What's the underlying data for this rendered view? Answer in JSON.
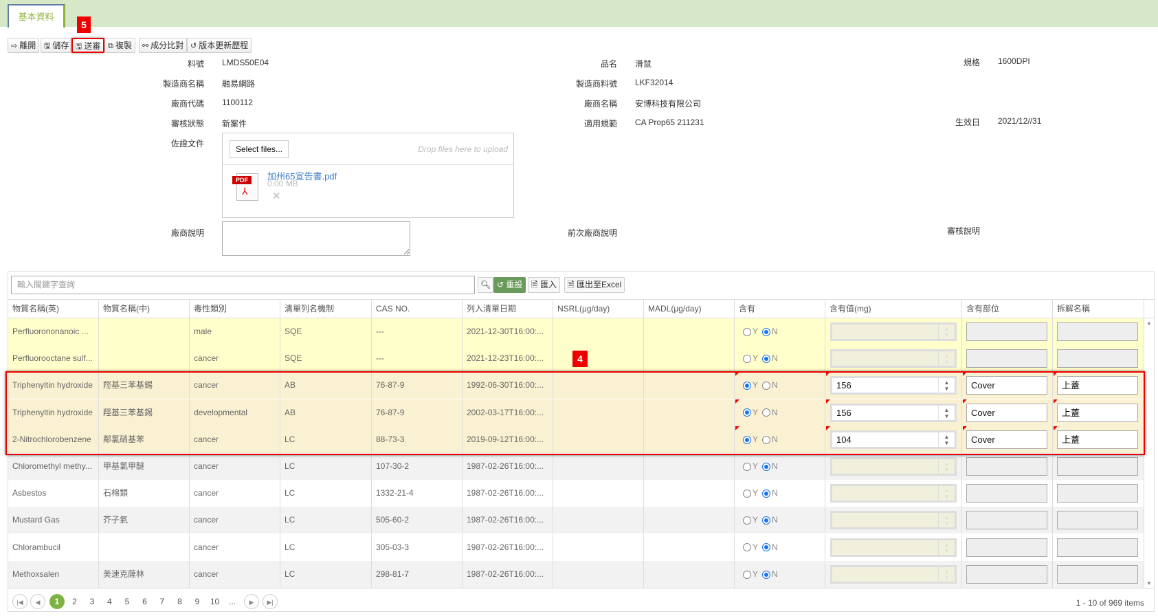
{
  "tab": "基本資料",
  "toolbar": [
    {
      "icon": "exit-icon",
      "glyph": "⇨",
      "label": "離開"
    },
    {
      "icon": "save-icon",
      "glyph": "🖫",
      "label": "儲存"
    },
    {
      "icon": "submit-icon",
      "glyph": "🖫",
      "label": "送審"
    },
    {
      "icon": "copy-icon",
      "glyph": "⧉",
      "label": "複製"
    },
    {
      "icon": "link-icon",
      "glyph": "⚯",
      "label": "成分比對"
    },
    {
      "icon": "history-icon",
      "glyph": "↺",
      "label": "版本更新歷程"
    }
  ],
  "annotations": {
    "submit": "5",
    "rows": "4"
  },
  "form": {
    "part_no": {
      "label": "料號",
      "value": "LMDS50E04"
    },
    "mfr_name": {
      "label": "製造商名稱",
      "value": "融易網路"
    },
    "vendor_code": {
      "label": "廠商代碼",
      "value": "1100112"
    },
    "review_status": {
      "label": "審核狀態",
      "value": "新案件"
    },
    "evidence": {
      "label": "佐證文件"
    },
    "product_name": {
      "label": "品名",
      "value": "滑鼠"
    },
    "mfr_part_no": {
      "label": "製造商料號",
      "value": "LKF32014"
    },
    "vendor_name": {
      "label": "廠商名稱",
      "value": "安博科技有限公司"
    },
    "regulation": {
      "label": "適用規範",
      "value": "CA Prop65 211231"
    },
    "spec": {
      "label": "規格",
      "value": "1600DPI"
    },
    "effective_date": {
      "label": "生效日",
      "value": "2021/12//31"
    },
    "vendor_note": {
      "label": "廠商說明",
      "value": ""
    },
    "prev_vendor_note": {
      "label": "前次廠商說明"
    },
    "review_note": {
      "label": "審核說明"
    }
  },
  "upload": {
    "select_label": "Select files...",
    "drop_hint": "Drop files here to upload",
    "file_name": "加州65宣告書.pdf",
    "file_size": "0.00 MB",
    "file_type": "PDF"
  },
  "grid": {
    "search_placeholder": "輸入關鍵字查詢",
    "reset_label": "重設",
    "import_label": "匯入",
    "export_label": "匯出至Excel",
    "columns": [
      "物質名稱(英)",
      "物質名稱(中)",
      "毒性類別",
      "清單列名機制",
      "CAS NO.",
      "列入清單日期",
      "NSRL(μg/day)",
      "MADL(μg/day)",
      "含有",
      "含有值(mg)",
      "含有部位",
      "拆解名稱"
    ],
    "rows": [
      {
        "en": "Perfluorononanoic ...",
        "zh": "",
        "tox": "male",
        "mech": "SQE",
        "cas": "---",
        "date": "2021-12-30T16:00:...",
        "nsrl": "",
        "madl": "",
        "contains": "N",
        "value": "",
        "part": "",
        "disassembly": "",
        "bg": "#ffffcc",
        "enabled": false
      },
      {
        "en": "Perfluorooctane sulf...",
        "zh": "",
        "tox": "cancer",
        "mech": "SQE",
        "cas": "---",
        "date": "2021-12-23T16:00:...",
        "nsrl": "",
        "madl": "",
        "contains": "N",
        "value": "",
        "part": "",
        "disassembly": "",
        "bg": "#ffffcc",
        "enabled": false
      },
      {
        "en": "Triphenyltin hydroxide",
        "zh": "羥基三苯基錫",
        "tox": "cancer",
        "mech": "AB",
        "cas": "76-87-9",
        "date": "1992-06-30T16:00:...",
        "nsrl": "",
        "madl": "",
        "contains": "Y",
        "value": "156",
        "part": "Cover",
        "disassembly": "上蓋",
        "bg": "#faf1d2",
        "enabled": true
      },
      {
        "en": "Triphenyltin hydroxide",
        "zh": "羥基三苯基錫",
        "tox": "developmental",
        "mech": "AB",
        "cas": "76-87-9",
        "date": "2002-03-17T16:00:...",
        "nsrl": "",
        "madl": "",
        "contains": "Y",
        "value": "156",
        "part": "Cover",
        "disassembly": "上蓋",
        "bg": "#faf1d2",
        "enabled": true
      },
      {
        "en": "2-Nitrochlorobenzene",
        "zh": "鄰氯硝基苯",
        "tox": "cancer",
        "mech": "LC",
        "cas": "88-73-3",
        "date": "2019-09-12T16:00:...",
        "nsrl": "",
        "madl": "",
        "contains": "Y",
        "value": "104",
        "part": "Cover",
        "disassembly": "上蓋",
        "bg": "#faf1d2",
        "enabled": true
      },
      {
        "en": "Chloromethyl methy...",
        "zh": "甲基氯甲醚",
        "tox": "cancer",
        "mech": "LC",
        "cas": "107-30-2",
        "date": "1987-02-26T16:00:...",
        "nsrl": "",
        "madl": "",
        "contains": "N",
        "value": "",
        "part": "",
        "disassembly": "",
        "bg": "#f2f2f2",
        "enabled": false
      },
      {
        "en": "Asbestos",
        "zh": "石棉類",
        "tox": "cancer",
        "mech": "LC",
        "cas": "1332-21-4",
        "date": "1987-02-26T16:00:...",
        "nsrl": "",
        "madl": "",
        "contains": "N",
        "value": "",
        "part": "",
        "disassembly": "",
        "bg": "#ffffff",
        "enabled": false
      },
      {
        "en": "Mustard Gas",
        "zh": "芥子氣",
        "tox": "cancer",
        "mech": "LC",
        "cas": "505-60-2",
        "date": "1987-02-26T16:00:...",
        "nsrl": "",
        "madl": "",
        "contains": "N",
        "value": "",
        "part": "",
        "disassembly": "",
        "bg": "#f2f2f2",
        "enabled": false
      },
      {
        "en": "Chlorambucil",
        "zh": "",
        "tox": "cancer",
        "mech": "LC",
        "cas": "305-03-3",
        "date": "1987-02-26T16:00:...",
        "nsrl": "",
        "madl": "",
        "contains": "N",
        "value": "",
        "part": "",
        "disassembly": "",
        "bg": "#ffffff",
        "enabled": false
      },
      {
        "en": "Methoxsalen",
        "zh": "美速克薩林",
        "tox": "cancer",
        "mech": "LC",
        "cas": "298-81-7",
        "date": "1987-02-26T16:00:...",
        "nsrl": "",
        "madl": "",
        "contains": "N",
        "value": "",
        "part": "",
        "disassembly": "",
        "bg": "#f2f2f2",
        "enabled": false
      }
    ],
    "radio_y": "Y",
    "radio_n": "N",
    "pager": {
      "pages": [
        "1",
        "2",
        "3",
        "4",
        "5",
        "6",
        "7",
        "8",
        "9",
        "10",
        "..."
      ],
      "current": "1",
      "summary": "1 - 10 of 969 items"
    }
  }
}
